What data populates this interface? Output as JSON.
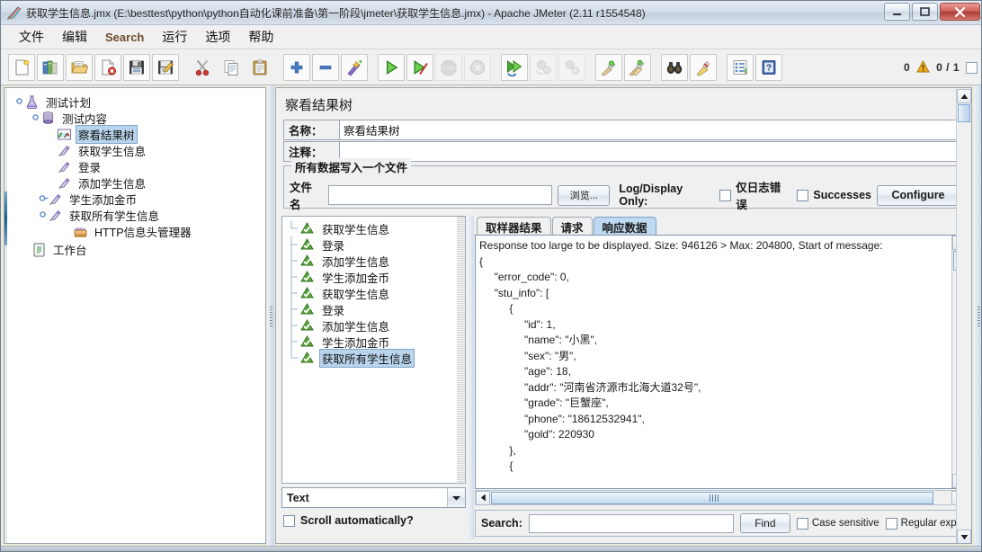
{
  "window": {
    "title": "获取学生信息.jmx (E:\\besttest\\python\\python自动化课前准备\\第一阶段\\jmeter\\获取学生信息.jmx) - Apache JMeter (2.11 r1554548)",
    "app_icon": "jmeter-feather-icon",
    "minimize_label": "—",
    "maximize_label": "▫",
    "close_label": "✕"
  },
  "menubar": {
    "items": [
      {
        "label": "文件",
        "name": "menu-file"
      },
      {
        "label": "编辑",
        "name": "menu-edit"
      },
      {
        "label": "Search",
        "name": "menu-search"
      },
      {
        "label": "运行",
        "name": "menu-run"
      },
      {
        "label": "选项",
        "name": "menu-options"
      },
      {
        "label": "帮助",
        "name": "menu-help"
      }
    ]
  },
  "toolbar": {
    "buttons": [
      {
        "name": "new-button",
        "icon": "new-document-icon"
      },
      {
        "name": "templates-button",
        "icon": "templates-icon"
      },
      {
        "name": "open-button",
        "icon": "open-folder-icon"
      },
      {
        "name": "close-button",
        "icon": "close-document-icon"
      },
      {
        "name": "save-button",
        "icon": "floppy-save-icon"
      },
      {
        "name": "save-as-button",
        "icon": "save-as-icon"
      },
      {
        "name": "cut-button",
        "icon": "scissors-icon"
      },
      {
        "name": "copy-button",
        "icon": "copy-icon"
      },
      {
        "name": "paste-button",
        "icon": "clipboard-paste-icon"
      },
      {
        "name": "expand-all-button",
        "icon": "plus-icon"
      },
      {
        "name": "collapse-all-button",
        "icon": "minus-icon"
      },
      {
        "name": "toggle-button",
        "icon": "toggle-wand-icon"
      },
      {
        "name": "start-button",
        "icon": "green-play-icon"
      },
      {
        "name": "start-no-timers-button",
        "icon": "play-no-timers-icon"
      },
      {
        "name": "stop-button",
        "icon": "stop-sign-icon"
      },
      {
        "name": "shutdown-button",
        "icon": "shutdown-circle-icon"
      },
      {
        "name": "remote-start-all-button",
        "icon": "remote-start-icon"
      },
      {
        "name": "remote-stop-all-button",
        "icon": "remote-stop-icon"
      },
      {
        "name": "remote-shutdown-all-button",
        "icon": "remote-shutdown-icon"
      },
      {
        "name": "clear-button",
        "icon": "clear-broom-icon"
      },
      {
        "name": "clear-all-button",
        "icon": "clear-all-broom-icon"
      },
      {
        "name": "search-button",
        "icon": "binoculars-icon"
      },
      {
        "name": "reset-search-button",
        "icon": "broom-reset-icon"
      },
      {
        "name": "function-helper-button",
        "icon": "function-list-icon"
      },
      {
        "name": "help-button",
        "icon": "help-book-icon"
      }
    ],
    "status": {
      "warning_count": "0",
      "warning_icon": "warning-triangle-icon",
      "thread_count": "0 / 1"
    }
  },
  "tree": {
    "nodes": [
      {
        "label": "测试计划",
        "icon": "test-plan-icon",
        "depth": 0,
        "handle": "expanded",
        "selected": false
      },
      {
        "label": "测试内容",
        "icon": "thread-group-icon",
        "depth": 1,
        "handle": "expanded",
        "selected": false
      },
      {
        "label": "察看结果树",
        "icon": "view-results-tree-icon",
        "depth": 2,
        "handle": "none",
        "selected": true
      },
      {
        "label": "获取学生信息",
        "icon": "http-sampler-icon",
        "depth": 2,
        "handle": "none",
        "selected": false
      },
      {
        "label": "登录",
        "icon": "http-sampler-icon",
        "depth": 2,
        "handle": "none",
        "selected": false
      },
      {
        "label": "添加学生信息",
        "icon": "http-sampler-icon",
        "depth": 2,
        "handle": "none",
        "selected": false
      },
      {
        "label": "学生添加金币",
        "icon": "http-sampler-icon",
        "depth": 2,
        "handle": "collapsed",
        "selected": false
      },
      {
        "label": "获取所有学生信息",
        "icon": "http-sampler-icon",
        "depth": 2,
        "handle": "expanded",
        "selected": false
      },
      {
        "label": "HTTP信息头管理器",
        "icon": "header-manager-icon",
        "depth": 3,
        "handle": "none",
        "selected": false
      },
      {
        "label": "工作台",
        "icon": "workbench-icon",
        "depth": 0,
        "handle": "none",
        "selected": false
      }
    ]
  },
  "panel": {
    "title": "察看结果树",
    "name_label": "名称：",
    "name_value": "察看结果树",
    "comment_label": "注释：",
    "comment_value": "",
    "file_group": {
      "legend": "所有数据写入一个文件",
      "filename_label": "文件名",
      "filename_value": "",
      "filename_placeholder": "",
      "browse_label": "浏览...",
      "log_display_label": "Log/Display Only:",
      "errors_only_label": "仅日志错误",
      "errors_only_checked": false,
      "successes_label": "Successes",
      "successes_checked": false,
      "configure_label": "Configure"
    }
  },
  "results_list": {
    "items": [
      {
        "label": "获取学生信息",
        "icon": "success-green-icon",
        "selected": false
      },
      {
        "label": "登录",
        "icon": "success-green-icon",
        "selected": false
      },
      {
        "label": "添加学生信息",
        "icon": "success-green-icon",
        "selected": false
      },
      {
        "label": "学生添加金币",
        "icon": "success-green-icon",
        "selected": false
      },
      {
        "label": "获取学生信息",
        "icon": "success-green-icon",
        "selected": false
      },
      {
        "label": "登录",
        "icon": "success-green-icon",
        "selected": false
      },
      {
        "label": "添加学生信息",
        "icon": "success-green-icon",
        "selected": false
      },
      {
        "label": "学生添加金币",
        "icon": "success-green-icon",
        "selected": false
      },
      {
        "label": "获取所有学生信息",
        "icon": "success-green-icon",
        "selected": true
      }
    ],
    "render_select_value": "Text",
    "scroll_auto_label": "Scroll automatically?",
    "scroll_auto_checked": false
  },
  "tabs": [
    {
      "label": "取样器结果",
      "name": "tab-sampler-result",
      "active": false
    },
    {
      "label": "请求",
      "name": "tab-request",
      "active": false
    },
    {
      "label": "响应数据",
      "name": "tab-response-data",
      "active": true
    }
  ],
  "response": {
    "text": "Response too large to be displayed. Size: 946126 > Max: 204800, Start of message:\n{\n     \"error_code\": 0,\n     \"stu_info\": [\n          {\n               \"id\": 1,\n               \"name\": \"小黑\",\n               \"sex\": \"男\",\n               \"age\": 18,\n               \"addr\": \"河南省济源市北海大道32号\",\n               \"grade\": \"巨蟹座\",\n               \"phone\": \"18612532941\",\n               \"gold\": 220930\n          },\n          {"
  },
  "search_bar": {
    "label": "Search:",
    "value": "",
    "placeholder": "",
    "find_label": "Find",
    "case_sensitive_label": "Case sensitive",
    "case_sensitive_checked": false,
    "regex_label": "Regular exp.",
    "regex_checked": false
  },
  "colors": {
    "selection_blue": "#b9d4ec",
    "active_tab_blue": "#bfd9f0",
    "success_green": "#49a03a",
    "menu_accent": "#6b4c2a"
  }
}
